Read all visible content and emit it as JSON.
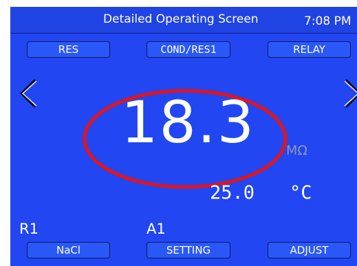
{
  "header": {
    "title": "Detailed Operating Screen",
    "time": "7:08 PM"
  },
  "top_buttons": {
    "res": "RES",
    "cond_res1": "COND/RES1",
    "relay": "RELAY"
  },
  "navigation": {
    "left_icon": "chevron-left-icon",
    "right_icon": "chevron-right-icon"
  },
  "reading": {
    "value": "18.3",
    "unit": "MΩ",
    "temperature": "25.0",
    "temperature_unit": "°C"
  },
  "channels": {
    "r1": "R1",
    "a1": "A1"
  },
  "bottom_buttons": {
    "nacl": "NaCl",
    "setting": "SETTING",
    "adjust": "ADJUST"
  },
  "colors": {
    "screen_background": "#2246f2",
    "button_background": "#2a58f8",
    "highlight_ellipse": "#e1141b",
    "unit_text": "#8f98b0",
    "text": "#ffffff"
  }
}
